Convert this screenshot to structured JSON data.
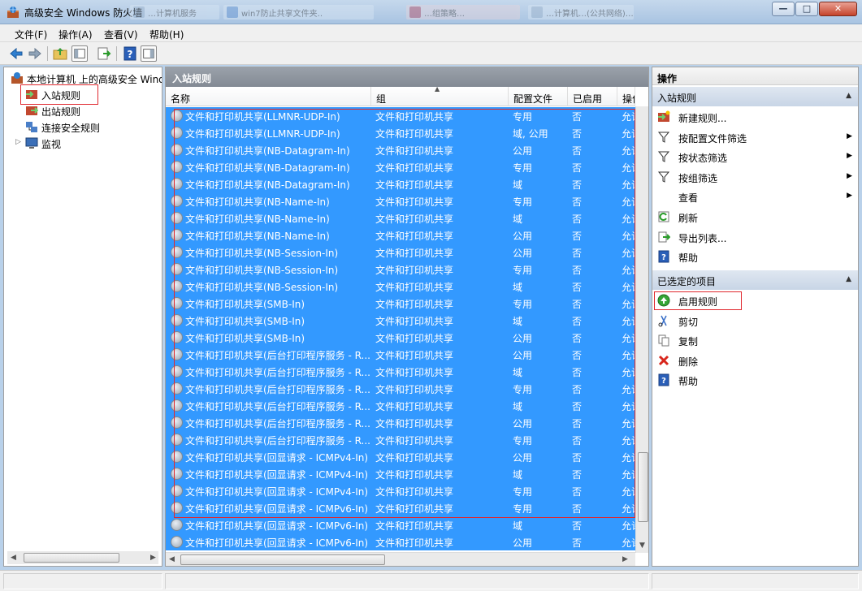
{
  "window": {
    "title": "高级安全 Windows 防火墙",
    "min": "—",
    "max": "□",
    "close": "✕"
  },
  "background_tabs": [
    "…计算机服务",
    "win7防止共享文件夹..",
    "…组策略…",
    "…计算机…(公共网络)…"
  ],
  "menu": [
    "文件(F)",
    "操作(A)",
    "查看(V)",
    "帮助(H)"
  ],
  "tree": {
    "root": "本地计算机 上的高级安全 Windows 防火墙",
    "items": [
      {
        "label": "入站规则",
        "icon": "inbound-rules-icon"
      },
      {
        "label": "出站规则",
        "icon": "outbound-rules-icon"
      },
      {
        "label": "连接安全规则",
        "icon": "connection-security-icon"
      },
      {
        "label": "监视",
        "icon": "monitor-icon"
      }
    ]
  },
  "list": {
    "title": "入站规则",
    "columns": [
      "名称",
      "组",
      "配置文件",
      "已启用",
      "操作"
    ],
    "rows": [
      [
        "文件和打印机共享(LLMNR-UDP-In)",
        "文件和打印机共享",
        "专用",
        "否",
        "允许"
      ],
      [
        "文件和打印机共享(LLMNR-UDP-In)",
        "文件和打印机共享",
        "域, 公用",
        "否",
        "允许"
      ],
      [
        "文件和打印机共享(NB-Datagram-In)",
        "文件和打印机共享",
        "公用",
        "否",
        "允许"
      ],
      [
        "文件和打印机共享(NB-Datagram-In)",
        "文件和打印机共享",
        "专用",
        "否",
        "允许"
      ],
      [
        "文件和打印机共享(NB-Datagram-In)",
        "文件和打印机共享",
        "域",
        "否",
        "允许"
      ],
      [
        "文件和打印机共享(NB-Name-In)",
        "文件和打印机共享",
        "专用",
        "否",
        "允许"
      ],
      [
        "文件和打印机共享(NB-Name-In)",
        "文件和打印机共享",
        "域",
        "否",
        "允许"
      ],
      [
        "文件和打印机共享(NB-Name-In)",
        "文件和打印机共享",
        "公用",
        "否",
        "允许"
      ],
      [
        "文件和打印机共享(NB-Session-In)",
        "文件和打印机共享",
        "公用",
        "否",
        "允许"
      ],
      [
        "文件和打印机共享(NB-Session-In)",
        "文件和打印机共享",
        "专用",
        "否",
        "允许"
      ],
      [
        "文件和打印机共享(NB-Session-In)",
        "文件和打印机共享",
        "域",
        "否",
        "允许"
      ],
      [
        "文件和打印机共享(SMB-In)",
        "文件和打印机共享",
        "专用",
        "否",
        "允许"
      ],
      [
        "文件和打印机共享(SMB-In)",
        "文件和打印机共享",
        "域",
        "否",
        "允许"
      ],
      [
        "文件和打印机共享(SMB-In)",
        "文件和打印机共享",
        "公用",
        "否",
        "允许"
      ],
      [
        "文件和打印机共享(后台打印程序服务 - R...",
        "文件和打印机共享",
        "公用",
        "否",
        "允许"
      ],
      [
        "文件和打印机共享(后台打印程序服务 - R...",
        "文件和打印机共享",
        "域",
        "否",
        "允许"
      ],
      [
        "文件和打印机共享(后台打印程序服务 - R...",
        "文件和打印机共享",
        "专用",
        "否",
        "允许"
      ],
      [
        "文件和打印机共享(后台打印程序服务 - R...",
        "文件和打印机共享",
        "域",
        "否",
        "允许"
      ],
      [
        "文件和打印机共享(后台打印程序服务 - R...",
        "文件和打印机共享",
        "公用",
        "否",
        "允许"
      ],
      [
        "文件和打印机共享(后台打印程序服务 - R...",
        "文件和打印机共享",
        "专用",
        "否",
        "允许"
      ],
      [
        "文件和打印机共享(回显请求 - ICMPv4-In)",
        "文件和打印机共享",
        "公用",
        "否",
        "允许"
      ],
      [
        "文件和打印机共享(回显请求 - ICMPv4-In)",
        "文件和打印机共享",
        "域",
        "否",
        "允许"
      ],
      [
        "文件和打印机共享(回显请求 - ICMPv4-In)",
        "文件和打印机共享",
        "专用",
        "否",
        "允许"
      ],
      [
        "文件和打印机共享(回显请求 - ICMPv6-In)",
        "文件和打印机共享",
        "专用",
        "否",
        "允许"
      ],
      [
        "文件和打印机共享(回显请求 - ICMPv6-In)",
        "文件和打印机共享",
        "域",
        "否",
        "允许"
      ],
      [
        "文件和打印机共享(回显请求 - ICMPv6-In)",
        "文件和打印机共享",
        "公用",
        "否",
        "允许"
      ]
    ]
  },
  "actions": {
    "title": "操作",
    "section1": {
      "title": "入站规则",
      "items": [
        {
          "label": "新建规则...",
          "icon": "new-rule-icon",
          "submenu": false
        },
        {
          "label": "按配置文件筛选",
          "icon": "filter-icon",
          "submenu": true
        },
        {
          "label": "按状态筛选",
          "icon": "filter-icon",
          "submenu": true
        },
        {
          "label": "按组筛选",
          "icon": "filter-icon",
          "submenu": true
        },
        {
          "label": "查看",
          "icon": "",
          "submenu": true
        },
        {
          "label": "刷新",
          "icon": "refresh-icon",
          "submenu": false
        },
        {
          "label": "导出列表...",
          "icon": "export-icon",
          "submenu": false
        },
        {
          "label": "帮助",
          "icon": "help-icon",
          "submenu": false
        }
      ]
    },
    "section2": {
      "title": "已选定的项目",
      "items": [
        {
          "label": "启用规则",
          "icon": "enable-rule-icon"
        },
        {
          "label": "剪切",
          "icon": "cut-icon"
        },
        {
          "label": "复制",
          "icon": "copy-icon"
        },
        {
          "label": "删除",
          "icon": "delete-icon"
        },
        {
          "label": "帮助",
          "icon": "help-icon"
        }
      ]
    }
  },
  "colors": {
    "selection": "#3399ff",
    "highlight_box": "#e0282e",
    "header": "#8b929b"
  }
}
